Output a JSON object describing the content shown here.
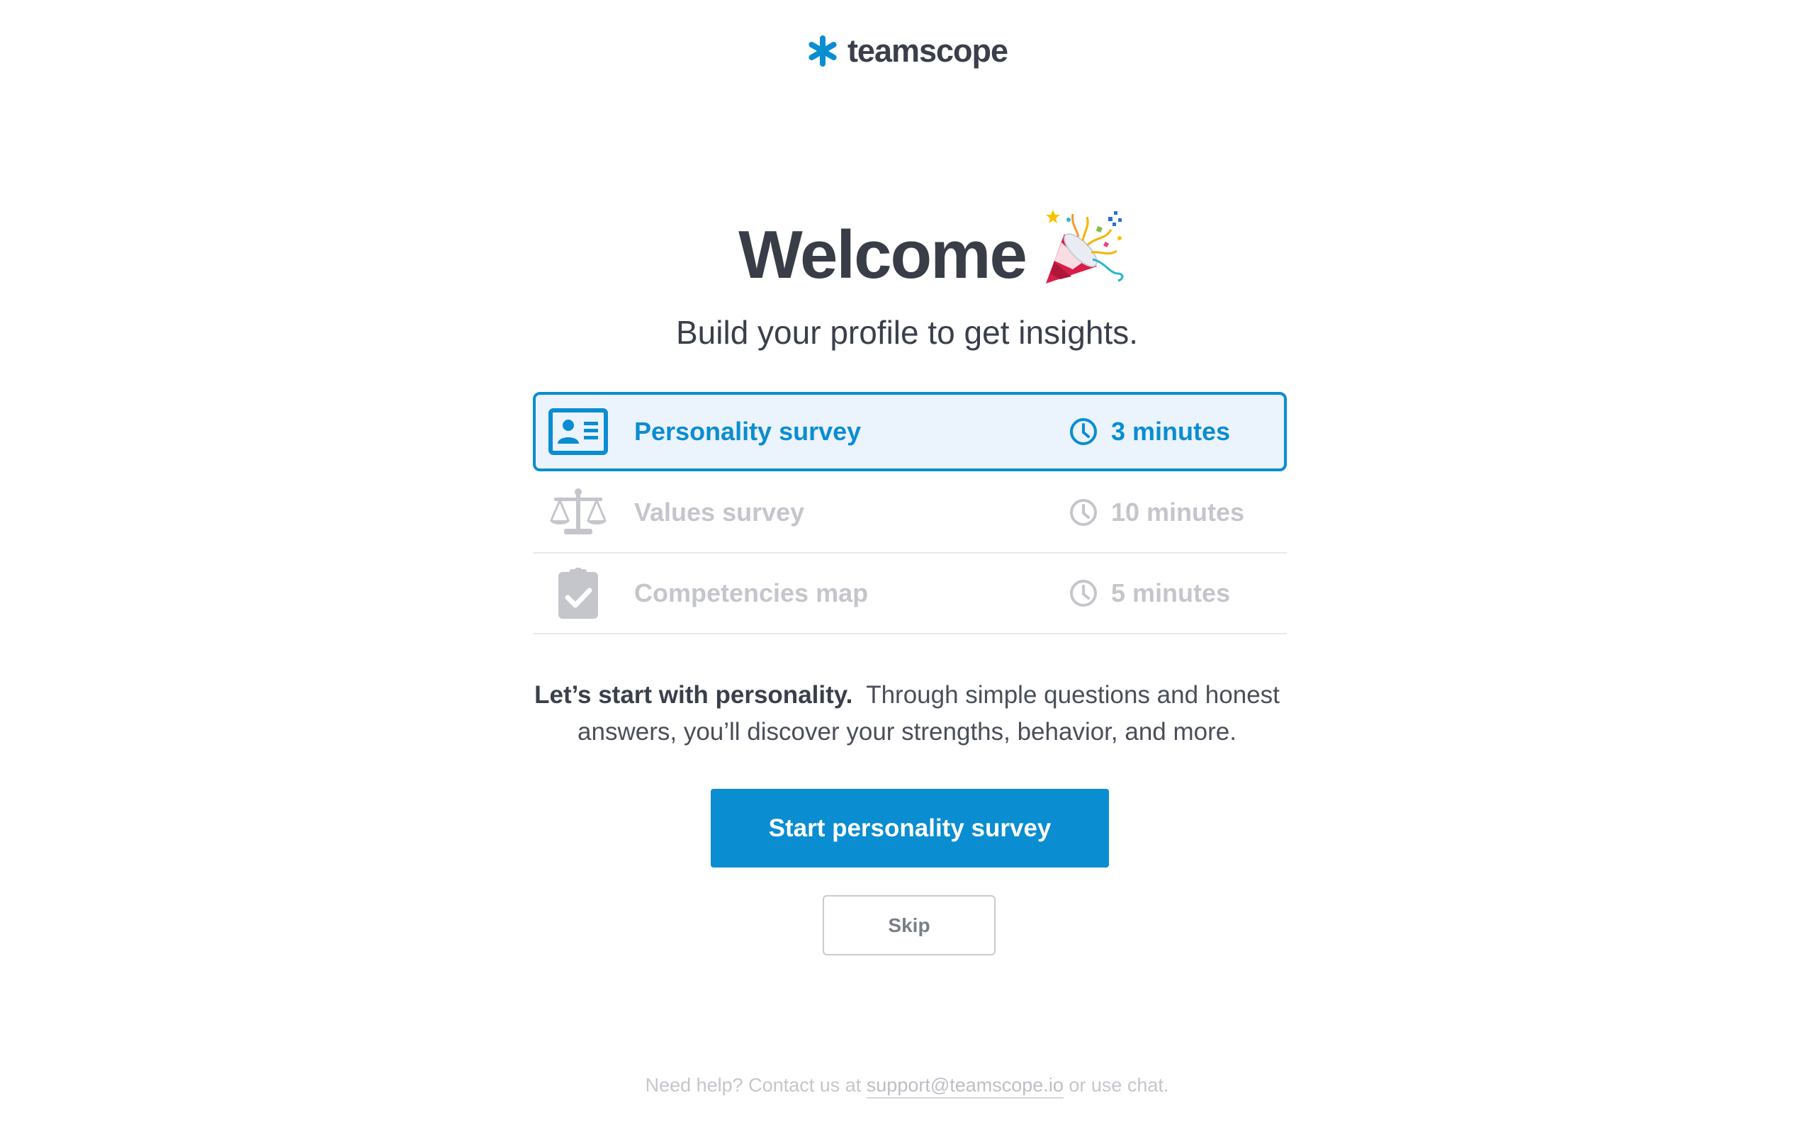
{
  "brand": {
    "name": "teamscope",
    "accent_color": "#0a8dd1",
    "logo_icon": "asterisk-logo-icon"
  },
  "welcome": {
    "title": "Welcome",
    "emoji_icon": "party-popper-icon",
    "subtitle": "Build your profile to get insights."
  },
  "surveys": [
    {
      "name": "Personality survey",
      "time": "3 minutes",
      "icon": "id-card-icon",
      "state": "active"
    },
    {
      "name": "Values survey",
      "time": "10 minutes",
      "icon": "balance-scale-icon",
      "state": "disabled"
    },
    {
      "name": "Competencies map",
      "time": "5 minutes",
      "icon": "clipboard-check-icon",
      "state": "disabled"
    }
  ],
  "description": {
    "lead": "Let’s start with personality.",
    "body": "Through simple questions and honest answers, you’ll discover your strengths, behavior, and more."
  },
  "actions": {
    "primary_label": "Start personality survey",
    "skip_label": "Skip"
  },
  "footer": {
    "prefix": "Need help? Contact us at",
    "email": "support@teamscope.io",
    "suffix": "or use chat."
  }
}
